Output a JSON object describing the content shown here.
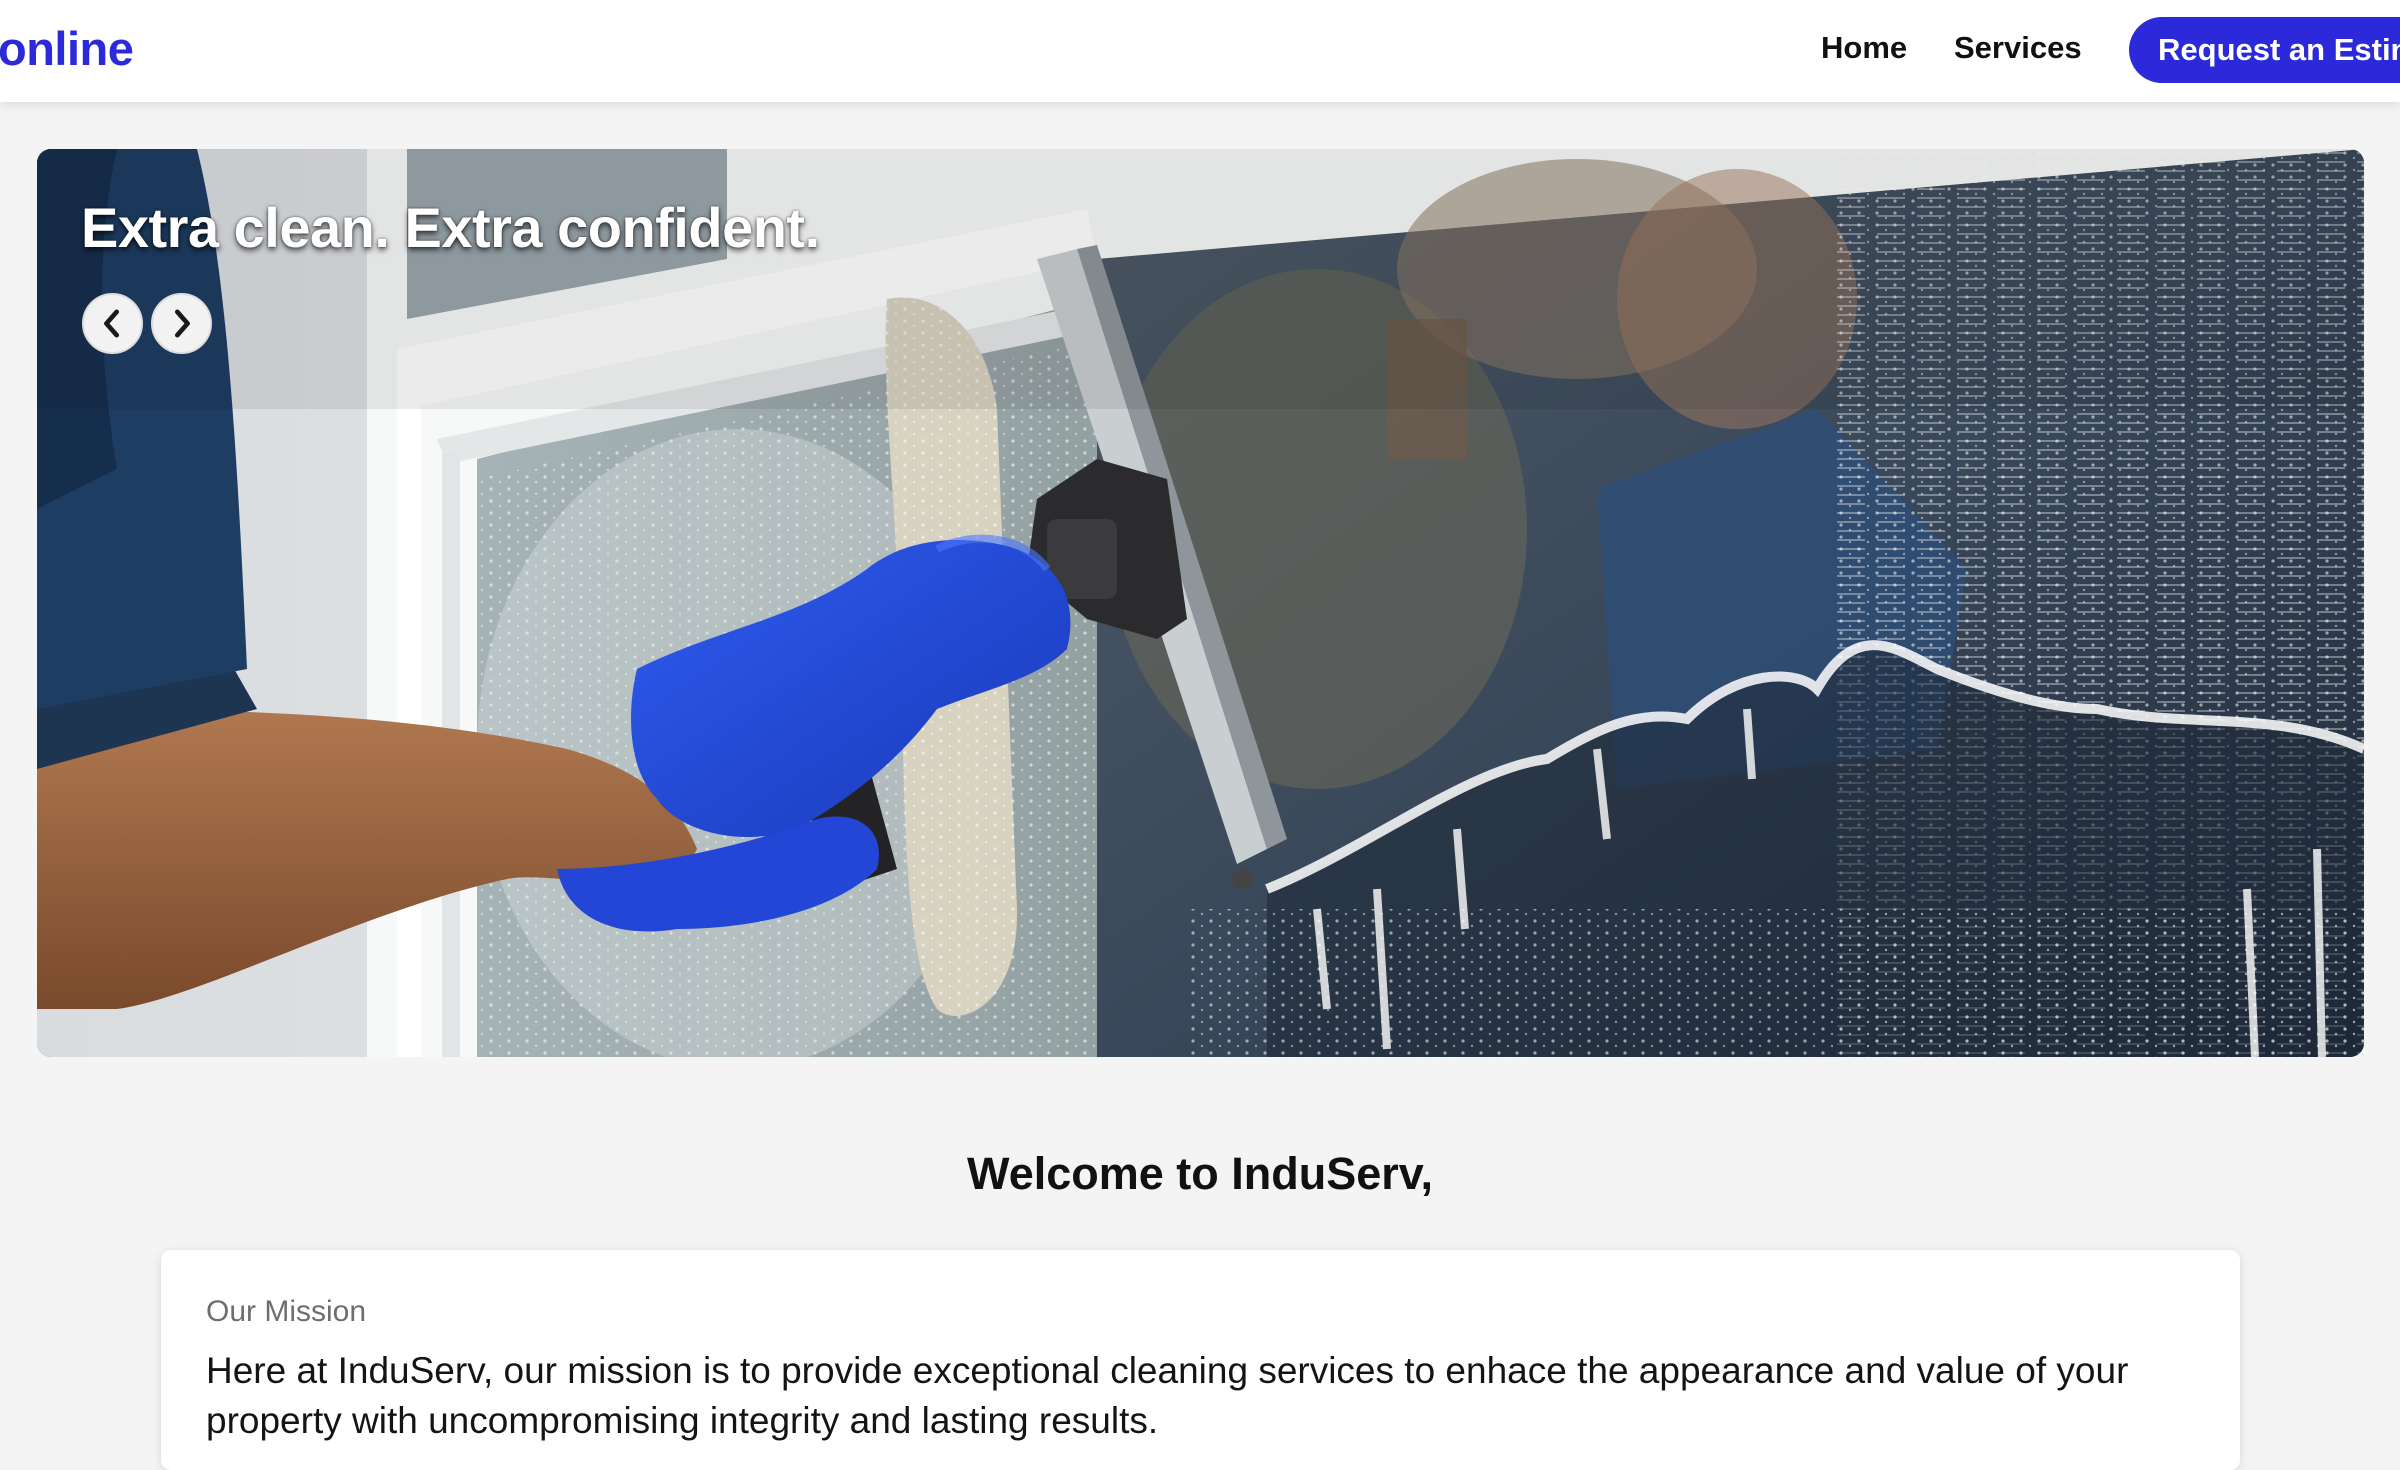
{
  "header": {
    "brand": "online",
    "nav": [
      {
        "label": "Home"
      },
      {
        "label": "Services"
      }
    ],
    "cta_label": "Request an Estimate",
    "brand_color": "#2b29d9"
  },
  "hero": {
    "title": "Extra clean. Extra confident.",
    "image": "window-cleaning-photo",
    "prev_icon": "chevron-left-icon",
    "next_icon": "chevron-right-icon"
  },
  "welcome": {
    "heading": "Welcome to InduServ,"
  },
  "mission": {
    "label": "Our Mission",
    "text": "Here at InduServ, our mission is to provide exceptional cleaning services to enhace the appearance and value of your property with uncompromising integrity and lasting results."
  }
}
